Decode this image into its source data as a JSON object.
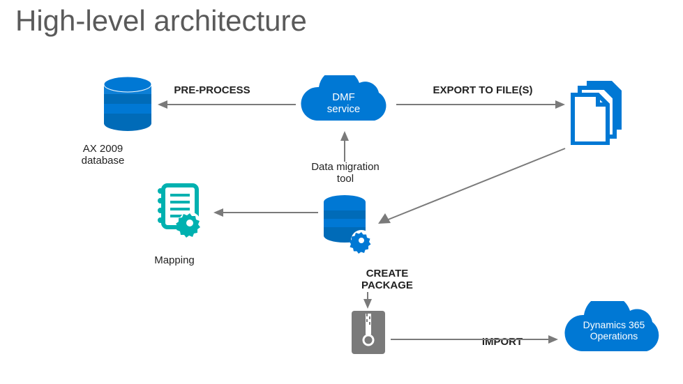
{
  "title": "High-level architecture",
  "nodes": {
    "ax2009": "AX 2009\ndatabase",
    "mapping": "Mapping",
    "dmf": "DMF\nservice",
    "dmt": "Data migration\ntool",
    "d365": "Dynamics 365\nOperations"
  },
  "edges": {
    "preprocess": "PRE-PROCESS",
    "export": "EXPORT TO FILE(S)",
    "create_package": "CREATE\nPACKAGE",
    "import": "IMPORT"
  },
  "colors": {
    "blue": "#0078d4",
    "teal": "#00b1b0",
    "grey": "#7a7a7a"
  }
}
